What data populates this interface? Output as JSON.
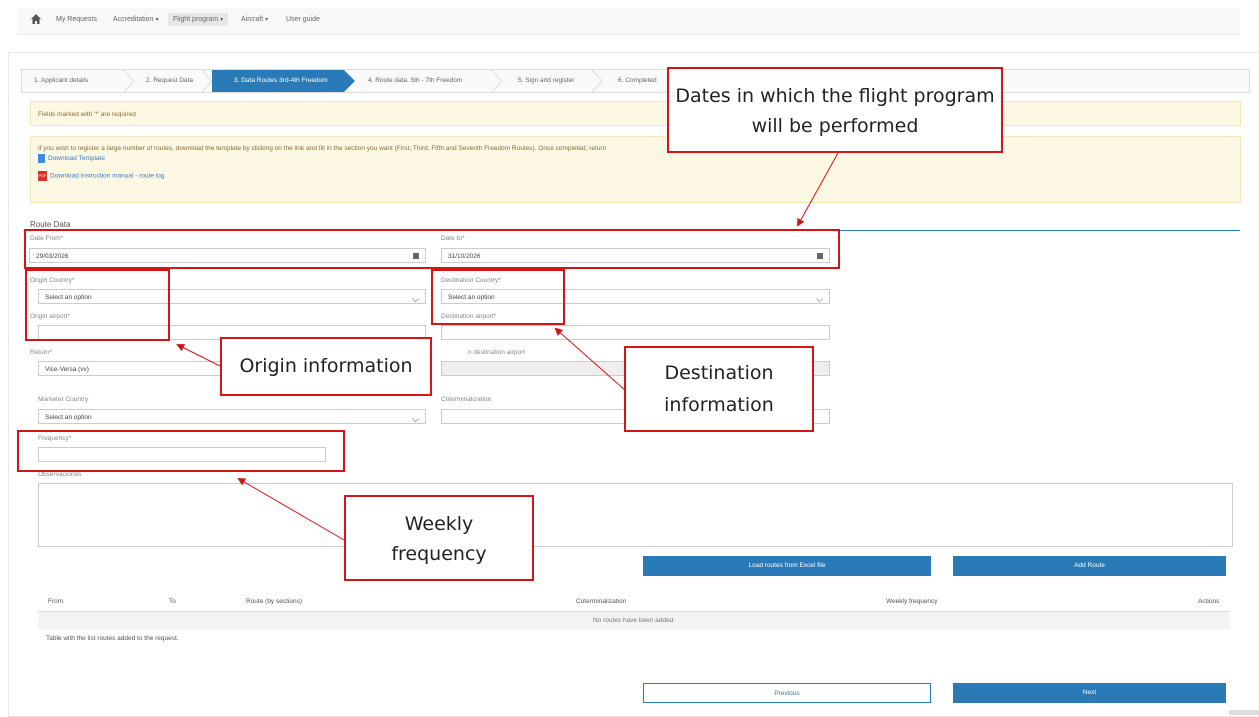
{
  "nav": {
    "items": [
      "My Requests",
      "Accreditation",
      "Flight program",
      "Aircraft",
      "User guide"
    ]
  },
  "steps": [
    "1. Applicant details",
    "2. Request Data",
    "3. Data Routes 3rd-4th Freedom",
    "4. Route data. 5th - 7th Freedom",
    "5. Sign and register",
    "6. Completed"
  ],
  "alerts": {
    "required": "Fields marked with '*' are required",
    "info": "If you wish to register a large number of routes, download the template by clicking on the link and fill in the section you want (First, Third, Fifth and Seventh Freedom Routes). Once completed, return",
    "download_template": "Download Template",
    "download_manual": "Download instruction manual - route log"
  },
  "form": {
    "section_title": "Route Data",
    "date_from_label": "Date From*",
    "date_from_value": "29/03/2026",
    "date_to_label": "Date to*",
    "date_to_value": "31/10/2026",
    "origin_country_label": "Origin Country*",
    "origin_country_value": "Select an option",
    "destination_country_label": "Destination Country*",
    "destination_country_value": "Select an option",
    "origin_airport_label": "Origin airport*",
    "destination_airport_label": "Destination airport*",
    "return_label": "Return*",
    "return_value": "Vice-Versa (vv)",
    "return_destination_label": "n destination airport",
    "marketer_country_label": "Marketer Country",
    "marketer_country_value": "Select an option",
    "coterminalization_label": "Coterminalization",
    "frequency_label": "Frequency*",
    "observaciones_label": "Observaciones"
  },
  "buttons": {
    "load_excel": "Load routes from Excel file",
    "add_route": "Add Route",
    "previous": "Previous",
    "next": "Next"
  },
  "table": {
    "headers": [
      "From",
      "To",
      "Route (by sections)",
      "Coterminalization",
      "Weekly frequency",
      "Actions"
    ],
    "empty": "No routes have been added.",
    "caption": "Table with the list routes added to the request."
  },
  "annotations": {
    "dates": "Dates in which the flight program will be performed",
    "origin": "Origin information",
    "destination": "Destination information",
    "frequency": "Weekly frequency"
  },
  "colors": {
    "primary": "#2a7ab8",
    "annotation": "#d41515",
    "alert_bg": "#fcf8e3"
  }
}
